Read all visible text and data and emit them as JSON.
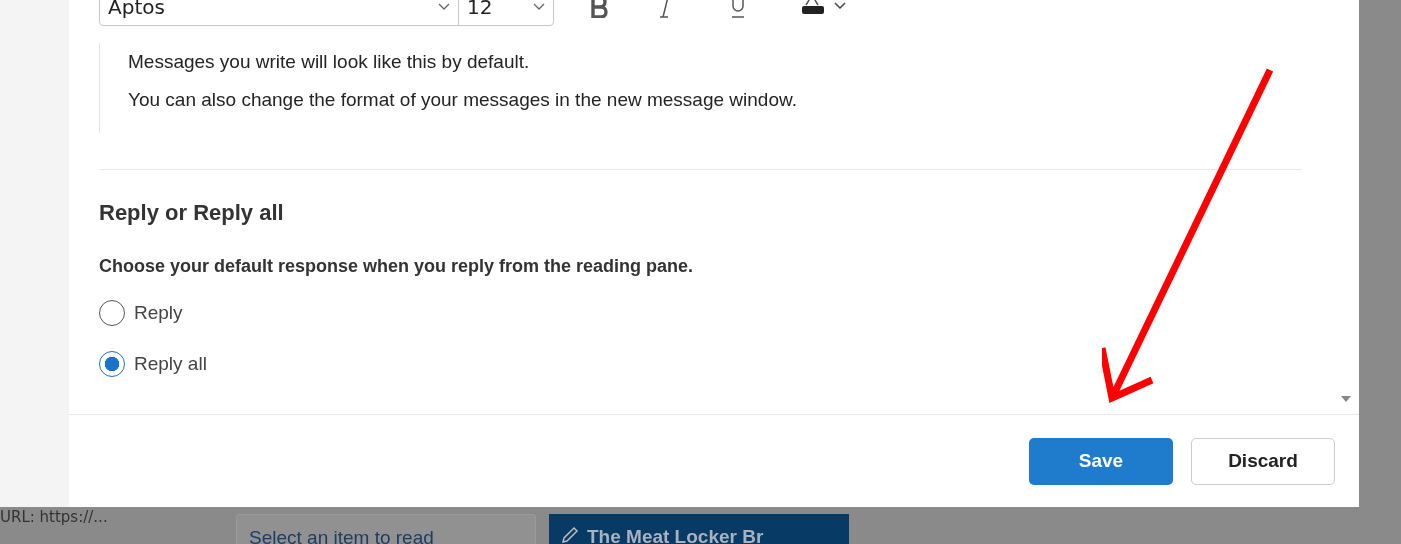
{
  "format_toolbar": {
    "font": "Aptos",
    "size": "12"
  },
  "preview_lines": [
    "Messages you write will look like this by default.",
    "You can also change the format of your messages in the new message window."
  ],
  "reply_section": {
    "title": "Reply or Reply all",
    "description": "Choose your default response when you reply from the reading pane.",
    "options": [
      {
        "label": "Reply",
        "selected": false
      },
      {
        "label": "Reply all",
        "selected": true
      }
    ]
  },
  "buttons": [
    {
      "label": "Save",
      "kind": "primary"
    },
    {
      "label": "Discard",
      "kind": "secondary"
    }
  ],
  "background": {
    "message_preview": "URL: https://...",
    "reading_pane": "Select an item to read",
    "compose_tab": "The Meat Locker Br"
  }
}
